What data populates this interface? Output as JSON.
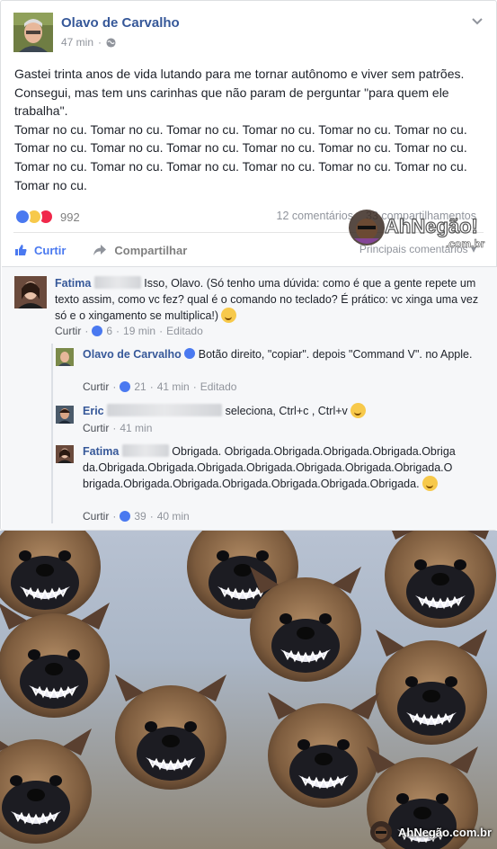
{
  "post": {
    "author": "Olavo de Carvalho",
    "time": "47 min",
    "text_p1": "Gastei trinta anos de vida lutando para me tornar autônomo e viver sem patrões. Consegui, mas tem uns carinhas que não param de perguntar \"para quem ele trabalha\".",
    "text_p2": "Tomar no cu. Tomar no cu. Tomar no cu. Tomar no cu. Tomar no cu. Tomar no cu. Tomar no cu. Tomar no cu. Tomar no cu. Tomar no cu. Tomar no cu. Tomar no cu. Tomar no cu. Tomar no cu. Tomar no cu. Tomar no cu. Tomar no cu. Tomar no cu. Tomar no cu.",
    "reaction_count": "992",
    "comments_count": "12 comentários",
    "shares_count": "33 compartilhamentos",
    "sort_label": "Principais comentários",
    "like_label": "Curtir",
    "share_label": "Compartilhar"
  },
  "comments": [
    {
      "name": "Fatima",
      "text": "Isso, Olavo. (Só tenho uma dúvida: como é que a gente repete um texto assim, como vc fez? qual é o comando no teclado? É prático: vc xinga uma vez só e o xingamento se multiplica!)",
      "like": "Curtir",
      "likes": "6",
      "time": "19 min",
      "edited": "Editado"
    },
    {
      "name": "Olavo de Carvalho",
      "text": "Botão direito, \"copiar\". depois \"Command V\". no Apple.",
      "like": "Curtir",
      "likes": "21",
      "time": "41 min",
      "edited": "Editado"
    },
    {
      "name": "Eric",
      "text": "seleciona, Ctrl+c , Ctrl+v",
      "like": "Curtir",
      "time": "41 min"
    },
    {
      "name": "Fatima",
      "text": "Obrigada. Obrigada.Obrigada.Obrigada.Obrigada.Obrigada.Obrigada.Obrigada.Obrigada.Obrigada.Obrigada.Obrigada.Obrigada.Obrigada.Obrigada.Obrigada.Obrigada.Obrigada.Obrigada.Obrigada.",
      "like": "Curtir",
      "likes": "39",
      "time": "40 min"
    }
  ],
  "watermark": {
    "top": "AhNegão!",
    "top_sub": ".com.br",
    "bottom": "AhNegão.com.br"
  },
  "colors": {
    "link": "#365899",
    "like": "#4a79f0",
    "love": "#f0284a",
    "haha": "#f7c94b"
  }
}
